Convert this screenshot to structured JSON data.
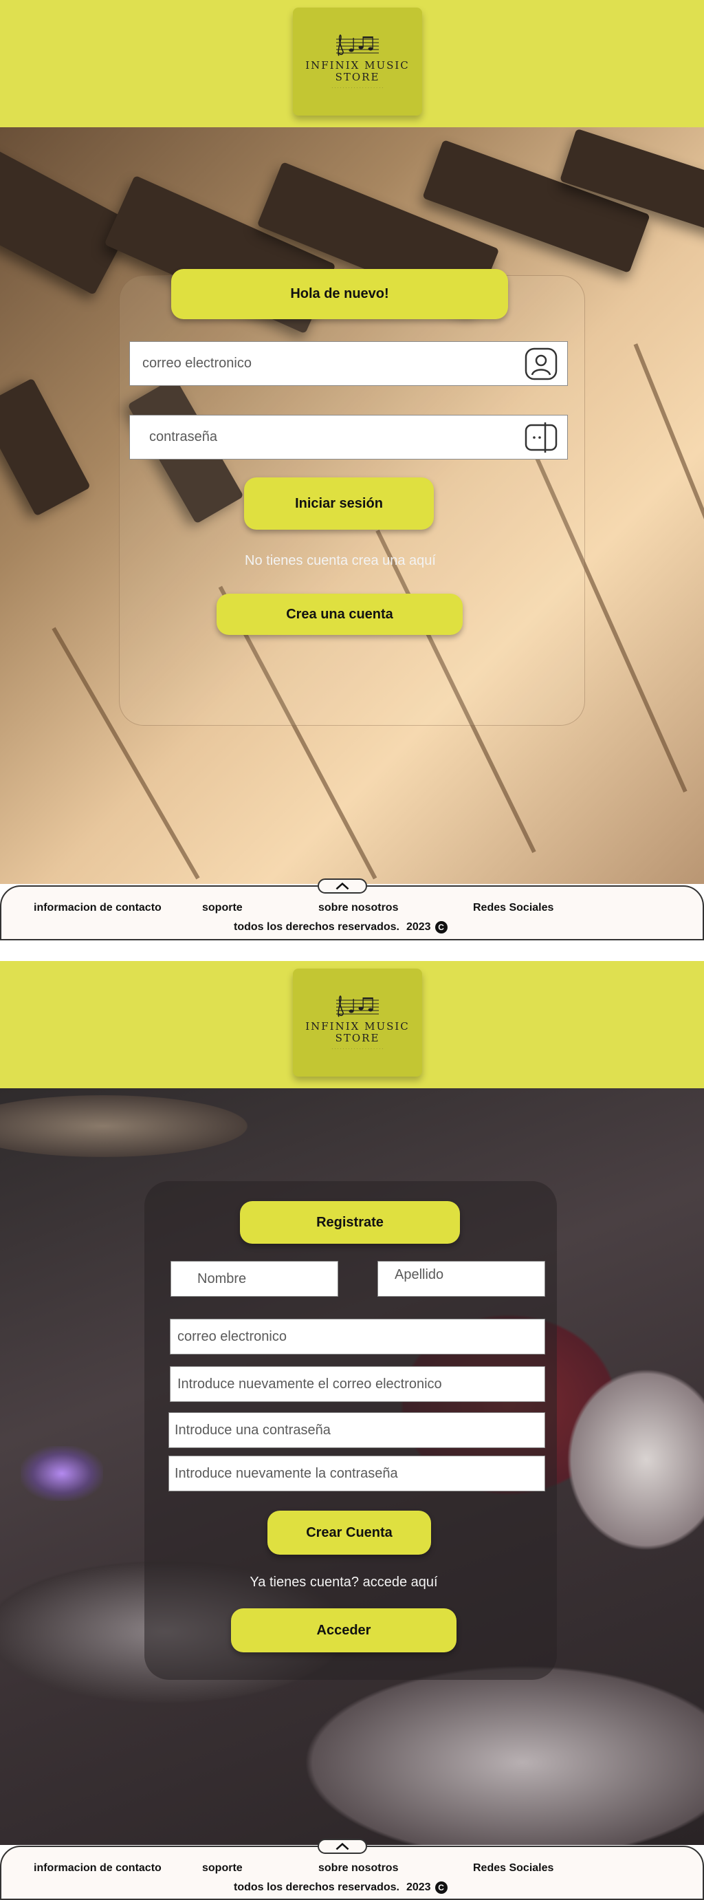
{
  "brand": {
    "line1": "INFINIX MUSIC",
    "line2": "STORE"
  },
  "login": {
    "title": "Hola de nuevo!",
    "email_placeholder": "correo electronico",
    "password_placeholder": "contraseña",
    "submit_label": "Iniciar sesión",
    "no_account_text": "No tienes cuenta crea una aquí",
    "create_account_label": "Crea una cuenta"
  },
  "register": {
    "title": "Registrate",
    "first_name_placeholder": "Nombre",
    "last_name_placeholder": "Apellido",
    "email_placeholder": "correo electronico",
    "email_confirm_placeholder": "Introduce nuevamente el correo electronico",
    "password_placeholder": "Introduce una contraseña",
    "password_confirm_placeholder": "Introduce nuevamente la contraseña",
    "submit_label": "Crear Cuenta",
    "have_account_text": "Ya tienes cuenta? accede aquí",
    "login_label": "Acceder"
  },
  "footer": {
    "contact": "informacion de contacto",
    "support": "soporte",
    "about": "sobre nosotros",
    "social": "Redes Sociales",
    "rights": "todos los derechos reservados.",
    "year": "2023"
  },
  "colors": {
    "accent": "#dfe040",
    "header": "#dfe050",
    "logo_bg": "#c3c633"
  },
  "icons": {
    "email_field": "user-icon",
    "password_field": "lock-icon",
    "footer_toggle": "chevron-up-icon",
    "copyright": "copyright-icon"
  }
}
